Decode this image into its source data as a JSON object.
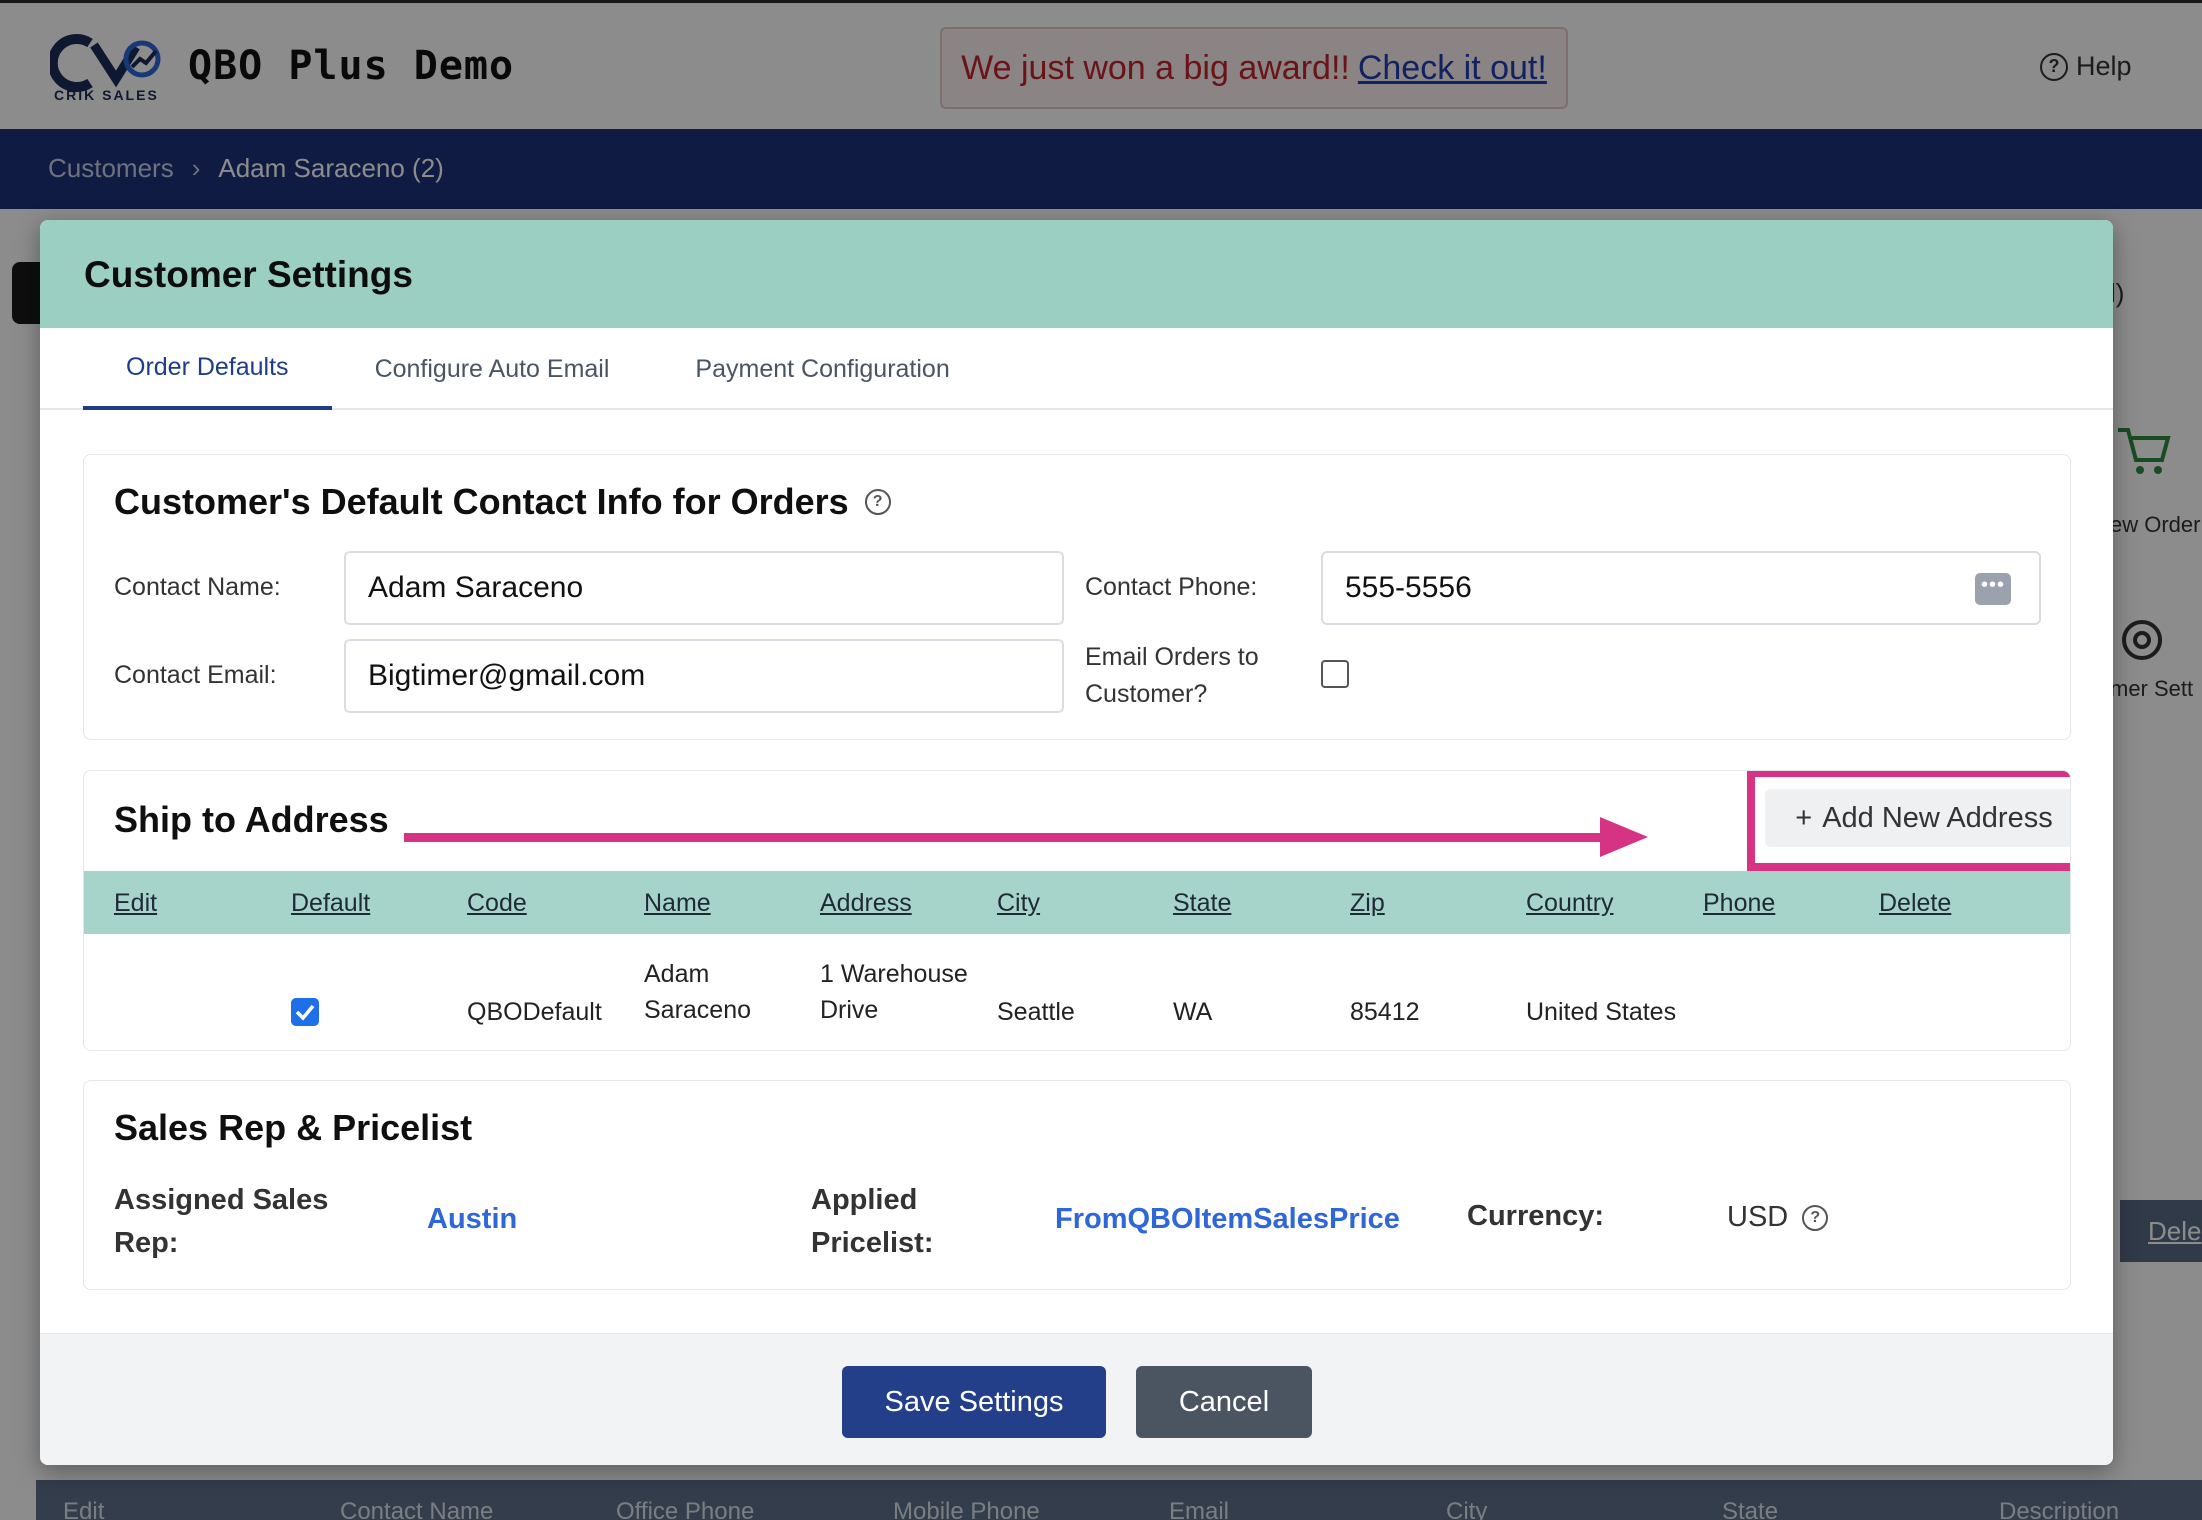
{
  "app": {
    "logo_sub": "CRIK SALES",
    "title": "QBO Plus Demo",
    "award_text": "We just won a big award!!",
    "award_link": "Check it out!",
    "help": "Help"
  },
  "breadcrumb": {
    "parent": "Customers",
    "separator": "›",
    "current": "Adam Saraceno (2)"
  },
  "background": {
    "paren_fragment": "l)",
    "side_new_order": "ew Order",
    "side_settings": "mer Sett",
    "dele": "Dele",
    "table_headers": [
      "Edit",
      "Contact Name",
      "Office Phone",
      "Mobile Phone",
      "Email",
      "City",
      "State",
      "Description"
    ]
  },
  "modal": {
    "title": "Customer Settings",
    "tabs": [
      {
        "label": "Order Defaults",
        "active": true
      },
      {
        "label": "Configure Auto Email",
        "active": false
      },
      {
        "label": "Payment Configuration",
        "active": false
      }
    ],
    "contact": {
      "title": "Customer's Default Contact Info for Orders",
      "name_label": "Contact Name:",
      "name_value": "Adam Saraceno",
      "phone_label": "Contact Phone:",
      "phone_value": "555-5556",
      "email_label": "Contact Email:",
      "email_value": "Bigtimer@gmail.com",
      "email_orders_label_1": "Email Orders to",
      "email_orders_label_2": "Customer?",
      "email_orders_checked": false
    },
    "ship": {
      "title": "Ship to Address",
      "add_button": "Add New Address",
      "columns": [
        "Edit",
        "Default",
        "Code",
        "Name",
        "Address",
        "City",
        "State",
        "Zip",
        "Country",
        "Phone",
        "Delete"
      ],
      "rows": [
        {
          "default": true,
          "code": "QBODefault",
          "name_1": "Adam",
          "name_2": "Saraceno",
          "address_1": "1 Warehouse",
          "address_2": "Drive",
          "city": "Seattle",
          "state": "WA",
          "zip": "85412",
          "country": "United States",
          "phone": ""
        }
      ]
    },
    "sales": {
      "title": "Sales Rep & Pricelist",
      "rep_label_1": "Assigned Sales",
      "rep_label_2": "Rep:",
      "rep_value": "Austin",
      "pricelist_label_1": "Applied",
      "pricelist_label_2": "Pricelist:",
      "pricelist_value": "FromQBOItemSalesPrice",
      "currency_label": "Currency:",
      "currency_value": "USD"
    },
    "footer": {
      "save": "Save Settings",
      "cancel": "Cancel"
    }
  },
  "colors": {
    "modal_header": "#9bcfc2",
    "table_header": "#a6d4ca",
    "primary": "#233f8a",
    "highlight": "#d63384",
    "link": "#2f67d9"
  }
}
